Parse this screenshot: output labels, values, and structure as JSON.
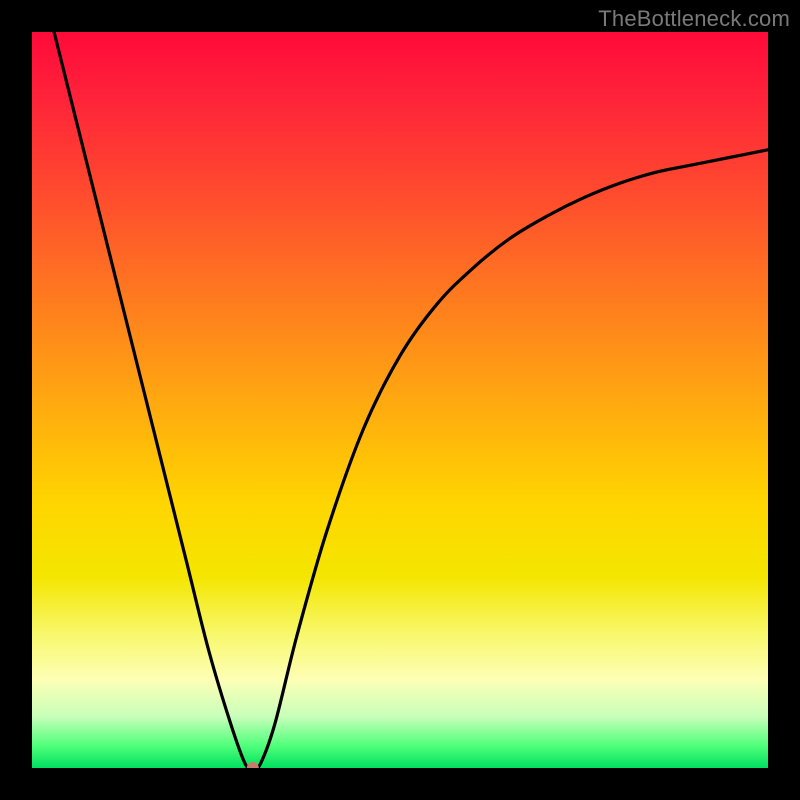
{
  "watermark": "TheBottleneck.com",
  "chart_data": {
    "type": "line",
    "title": "",
    "xlabel": "",
    "ylabel": "",
    "xlim": [
      0,
      100
    ],
    "ylim": [
      0,
      100
    ],
    "grid": false,
    "legend": false,
    "series": [
      {
        "name": "curve",
        "x": [
          3,
          6,
          9,
          12,
          15,
          18,
          21,
          24,
          27,
          29,
          30,
          31,
          33,
          36,
          40,
          45,
          50,
          55,
          60,
          65,
          70,
          75,
          80,
          85,
          90,
          95,
          100
        ],
        "y": [
          100,
          88,
          76,
          64,
          52,
          40,
          28,
          16,
          6,
          0.5,
          0,
          0.5,
          6,
          18,
          32,
          46,
          56,
          63,
          68,
          72,
          75,
          77.5,
          79.5,
          81,
          82,
          83,
          84
        ]
      }
    ],
    "marker": {
      "x": 30,
      "y": 0,
      "color": "#c77b6a",
      "radius_px": 6
    },
    "background_gradient": {
      "direction": "vertical",
      "stops": [
        {
          "pos": 0.0,
          "color": "#ff0a3a"
        },
        {
          "pos": 0.22,
          "color": "#ff4b2e"
        },
        {
          "pos": 0.5,
          "color": "#ffa810"
        },
        {
          "pos": 0.74,
          "color": "#f4e600"
        },
        {
          "pos": 0.88,
          "color": "#fdffb5"
        },
        {
          "pos": 0.97,
          "color": "#4fff7a"
        },
        {
          "pos": 1.0,
          "color": "#00e060"
        }
      ]
    }
  }
}
